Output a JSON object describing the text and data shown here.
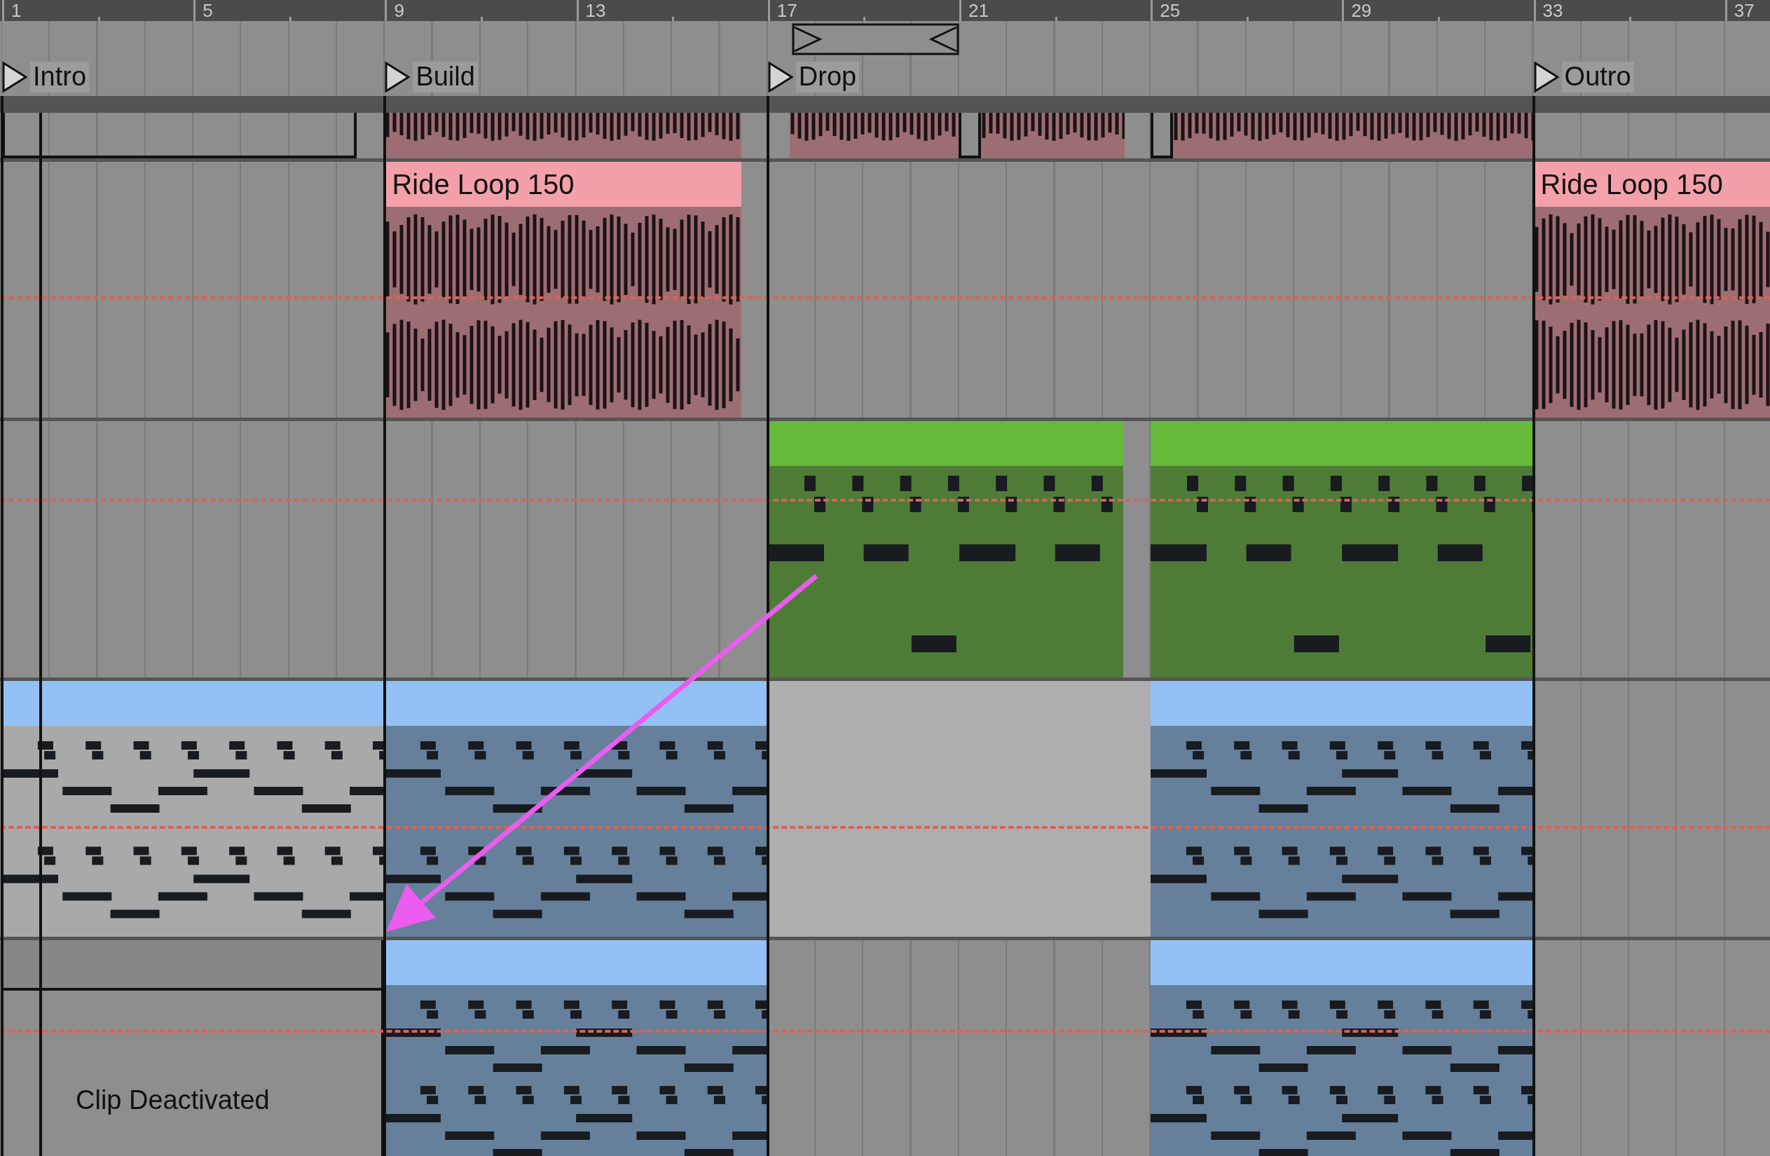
{
  "ruler": [
    "1",
    "5",
    "9",
    "13",
    "17",
    "21",
    "25",
    "29",
    "33",
    "37"
  ],
  "markers": [
    {
      "label": "Intro"
    },
    {
      "label": "Build"
    },
    {
      "label": "Drop"
    },
    {
      "label": "Outro"
    }
  ],
  "tracks": [
    {
      "show_headers": false,
      "automation_visible": false,
      "clips": [
        {
          "kind": "empty"
        },
        {
          "kind": "audio"
        },
        {
          "kind": "audio"
        },
        {
          "kind": "empty"
        },
        {
          "kind": "audio"
        },
        {
          "kind": "empty"
        },
        {
          "kind": "audio"
        }
      ]
    },
    {
      "show_headers": true,
      "automation_visible": true,
      "clips": [
        {
          "kind": "audio",
          "color": "#f4a0aa",
          "title": "Ride Loop 150"
        },
        {
          "kind": "audio",
          "color": "#f4a0aa",
          "title": "Ride Loop 150"
        }
      ]
    },
    {
      "show_headers": true,
      "automation_visible": true,
      "clips": [
        {
          "kind": "midi",
          "color": "#66bb3a",
          "active": true
        },
        {
          "kind": "midi",
          "color": "#66bb3a",
          "active": true
        }
      ]
    },
    {
      "show_headers": true,
      "automation_visible": true,
      "clips": [
        {
          "kind": "midi",
          "color": "#93c1f5",
          "active": false
        },
        {
          "kind": "midi",
          "color": "#93c1f5",
          "active": true
        },
        {
          "kind": "blank"
        },
        {
          "kind": "midi",
          "color": "#93c1f5",
          "active": true
        }
      ]
    },
    {
      "show_headers": true,
      "automation_visible": true,
      "clips": [
        {
          "kind": "deactivated",
          "label": "Clip Deactivated"
        },
        {
          "kind": "midi",
          "color": "#93c1f5",
          "active": true
        },
        {
          "kind": "midi",
          "color": "#93c1f5",
          "active": true
        }
      ]
    }
  ]
}
